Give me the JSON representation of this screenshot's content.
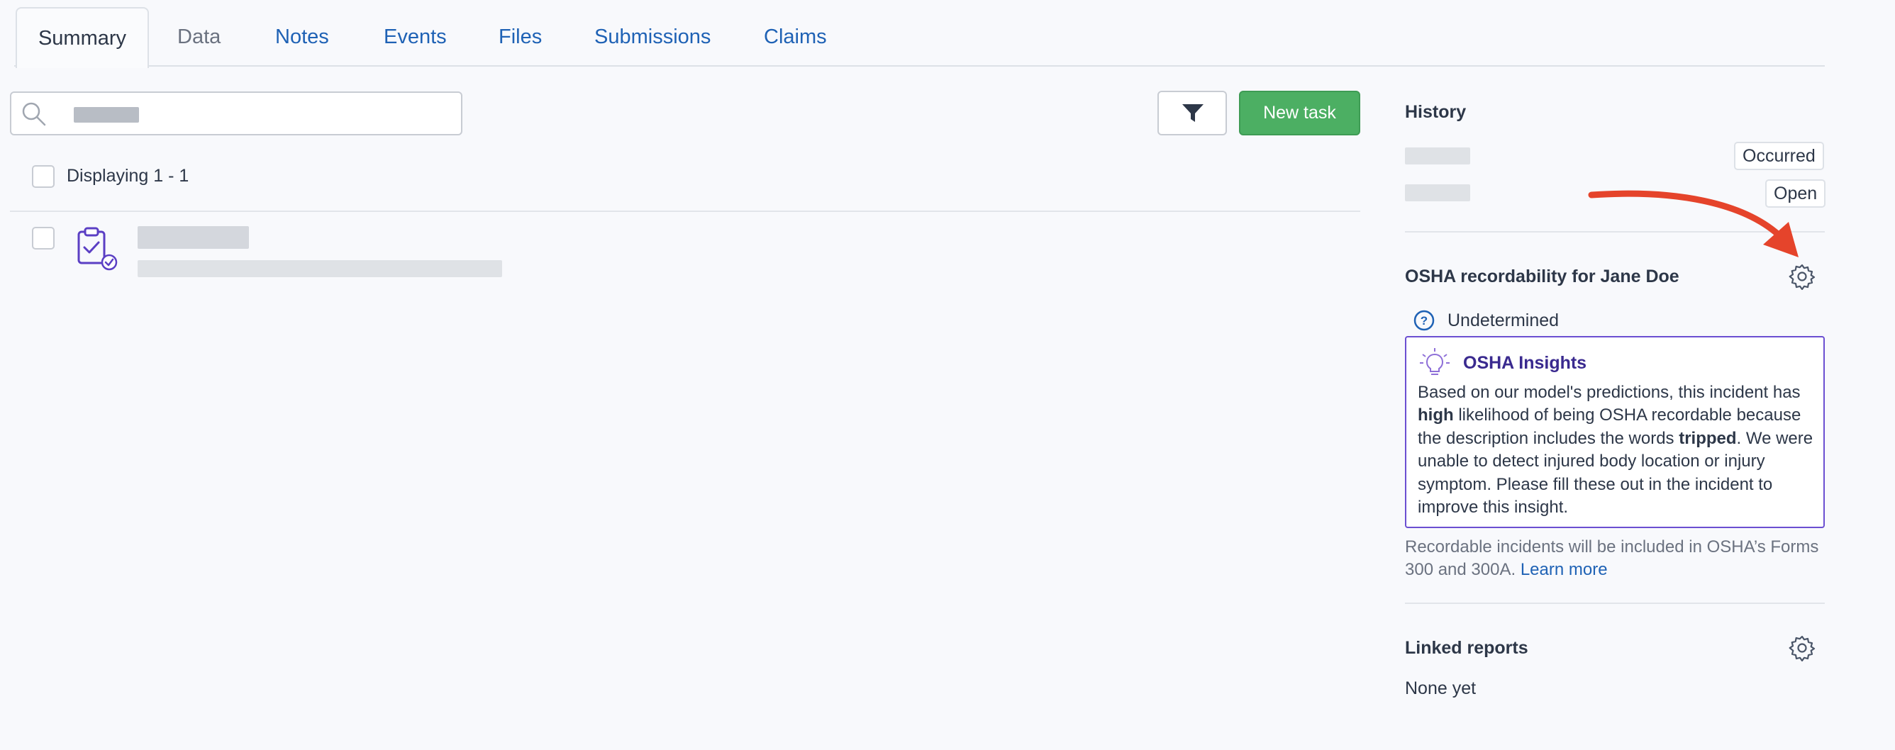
{
  "tabs": [
    {
      "label": "Summary",
      "active": true
    },
    {
      "label": "Data"
    },
    {
      "label": "Notes"
    },
    {
      "label": "Events"
    },
    {
      "label": "Files"
    },
    {
      "label": "Submissions"
    },
    {
      "label": "Claims"
    }
  ],
  "toolbar": {
    "search_placeholder": "",
    "new_task_label": "New task",
    "filter_icon": "filter-icon"
  },
  "list": {
    "displaying": "Displaying 1 - 1",
    "task_icon": "clipboard-check-icon"
  },
  "history": {
    "title": "History",
    "badges": [
      "Occurred",
      "Open"
    ]
  },
  "osha": {
    "title": "OSHA recordability for Jane Doe",
    "status": "Undetermined",
    "insights_title": "OSHA Insights",
    "body_1": "Based on our model's predictions, this incident has ",
    "body_bold_1": "high",
    "body_2": " likelihood of being OSHA recordable because the description includes the words ",
    "body_bold_2": "tripped",
    "body_3": ". We were unable to detect injured body location or injury symptom. Please fill these out in the incident to improve this insight.",
    "footnote": "Recordable incidents will be included in OSHA’s Forms 300 and 300A. ",
    "learn_more": "Learn more"
  },
  "linked_reports": {
    "title": "Linked reports",
    "empty": "None yet"
  },
  "colors": {
    "accent": "#1f62b5",
    "primary_button": "#4caf63",
    "insights_border": "#6b4fd1",
    "annotation_arrow": "#e5442b"
  }
}
